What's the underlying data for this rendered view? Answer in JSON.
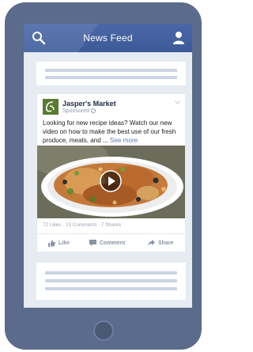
{
  "navbar": {
    "title": "News Feed",
    "left_icon": "search-icon",
    "right_icon": "user-icon",
    "color": "#3d5a98"
  },
  "post": {
    "page_name": "Jasper's Market",
    "sponsored_label": "Sponsored",
    "text": "Looking for new recipe ideas? Watch our new video on how to make the best use of our fresh produce, meats, and ...",
    "see_more": "See more",
    "engagement": "72 Likes · 13 Comments · 7 Shares",
    "actions": {
      "like": "Like",
      "comment": "Comment",
      "share": "Share"
    }
  },
  "colors": {
    "phone_body": "#5b6b8c",
    "screen_bg": "#e7ebf2",
    "link": "#5b79b8"
  }
}
